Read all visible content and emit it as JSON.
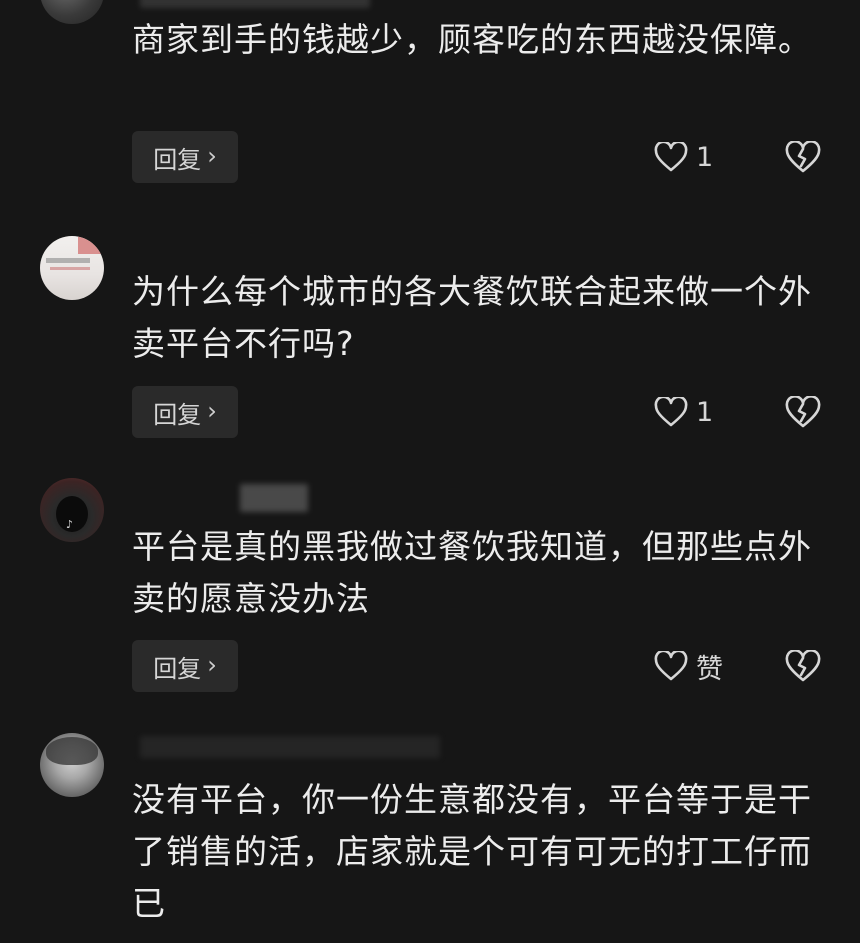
{
  "comments": [
    {
      "text": "商家到手的钱越少，顾客吃的东西越没保障。",
      "reply_label": "回复",
      "like_count": "1"
    },
    {
      "text": "为什么每个城市的各大餐饮联合起来做一个外卖平台不行吗?",
      "reply_label": "回复",
      "like_count": "1"
    },
    {
      "text": "平台是真的黑我做过餐饮我知道，但那些点外卖的愿意没办法",
      "reply_label": "回复",
      "like_count": "赞"
    },
    {
      "text": "没有平台，你一份生意都没有，平台等于是干了销售的活，店家就是个可有可无的打工仔而已"
    }
  ],
  "icons": {
    "like": "heart-outline-icon",
    "dislike": "broken-heart-icon",
    "reply_chevron": "chevron-right-icon"
  },
  "colors": {
    "background": "#161616",
    "text": "#ececec",
    "button_bg": "#2a2a2a"
  }
}
